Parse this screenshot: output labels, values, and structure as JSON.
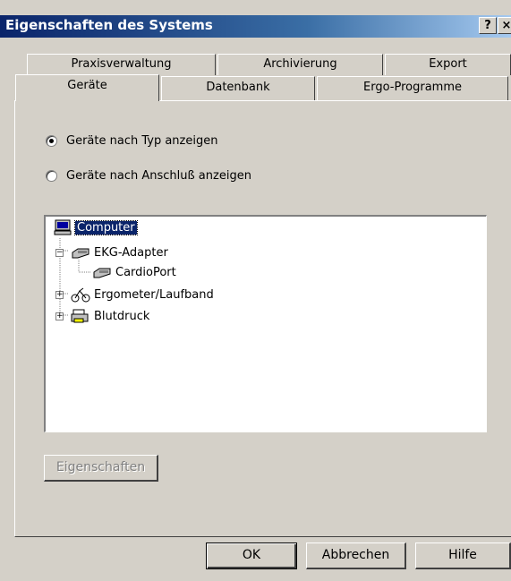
{
  "window": {
    "title": "Eigenschaften des Systems",
    "help_btn": "?",
    "close_btn": "×"
  },
  "tabs_row1": [
    "Praxisverwaltung",
    "Archivierung",
    "Export"
  ],
  "tabs_row2": [
    "Geräte",
    "Datenbank",
    "Ergo-Programme"
  ],
  "radios": [
    {
      "label": "Geräte nach Typ anzeigen",
      "checked": true
    },
    {
      "label": "Geräte nach Anschluß anzeigen",
      "checked": false
    }
  ],
  "tree": {
    "items": [
      {
        "label": "Computer",
        "icon": "computer-icon",
        "selected": true
      },
      {
        "label": "EKG-Adapter",
        "icon": "adapter-icon",
        "expander": "−"
      },
      {
        "label": "CardioPort",
        "icon": "adapter-icon"
      },
      {
        "label": "Ergometer/Laufband",
        "icon": "ergometer-icon",
        "expander": "+"
      },
      {
        "label": "Blutdruck",
        "icon": "printer-icon",
        "expander": "+"
      }
    ]
  },
  "buttons": {
    "properties": "Eigenschaften",
    "ok": "OK",
    "cancel": "Abbrechen",
    "help": "Hilfe"
  }
}
